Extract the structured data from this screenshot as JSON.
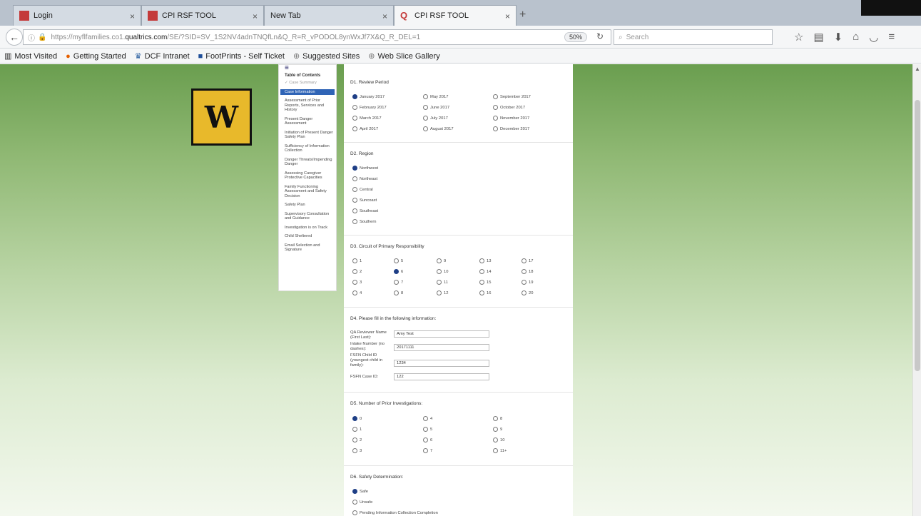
{
  "browser": {
    "tabs": [
      {
        "label": "Login"
      },
      {
        "label": "CPI RSF TOOL"
      },
      {
        "label": "New Tab"
      },
      {
        "label": "CPI RSF TOOL"
      }
    ],
    "url_prefix": "https://myflfamilies.co1.",
    "url_domain": "qualtrics.com",
    "url_path": "/SE/?SID=SV_1S2NV4adnTNQfLn&Q_R=R_vPODOL8ynWxJf7X&Q_R_DEL=1",
    "zoom": "50%",
    "search_placeholder": "Search",
    "bookmarks": [
      "Most Visited",
      "Getting Started",
      "DCF Intranet",
      "FootPrints - Self Ticket",
      "Suggested Sites",
      "Web Slice Gallery"
    ]
  },
  "logo_letter": "W",
  "toc": {
    "title": "Table of Contents",
    "items": [
      "✓ Case Summary",
      "Case Information",
      "Assessment of Prior Reports, Services and History",
      "Present Danger Assessment",
      "Initiation of Present Danger Safety Plan",
      "Sufficiency of Information Collection",
      "Danger Threats/Impending Danger",
      "Assessing Caregiver Protective Capacities",
      "Family Functioning Assessment and Safety Decision",
      "Safety Plan",
      "Supervisory Consultation and Guidance",
      "Investigation is on Track",
      "Child Sheltered",
      "Email Selection and Signature"
    ]
  },
  "survey": {
    "d1": {
      "title": "D1. Review Period",
      "options": [
        "January 2017",
        "February 2017",
        "March 2017",
        "April 2017",
        "May 2017",
        "June 2017",
        "July 2017",
        "August 2017",
        "September 2017",
        "October 2017",
        "November 2017",
        "December 2017"
      ]
    },
    "d2": {
      "title": "D2. Region",
      "options": [
        "Northwest",
        "Northeast",
        "Central",
        "Suncoast",
        "Southeast",
        "Southern"
      ]
    },
    "d3": {
      "title": "D3. Circuit of Primary Responsibility",
      "options": [
        "1",
        "2",
        "3",
        "4",
        "5",
        "6",
        "7",
        "8",
        "9",
        "10",
        "11",
        "12",
        "13",
        "14",
        "15",
        "16",
        "17",
        "18",
        "19",
        "20"
      ]
    },
    "d4": {
      "title": "D4. Please fill in the following information:",
      "fields": [
        {
          "label": "QA Reviewer Name (First Last):",
          "value": "Amy Test"
        },
        {
          "label": "Intake Number (no dashes):",
          "value": "20171111"
        },
        {
          "label": "FSFN Child ID (youngest child in family):",
          "value": "1234"
        },
        {
          "label": "FSFN Case ID:",
          "value": "122"
        }
      ]
    },
    "d5": {
      "title": "D5. Number of Prior Investigations:",
      "options": [
        "0",
        "1",
        "2",
        "3",
        "4",
        "5",
        "6",
        "7",
        "8",
        "9",
        "10",
        "11+"
      ]
    },
    "d6": {
      "title": "D6. Safety Determination:",
      "options": [
        "Safe",
        "Unsafe",
        "Pending Information Collection Completion"
      ]
    }
  }
}
